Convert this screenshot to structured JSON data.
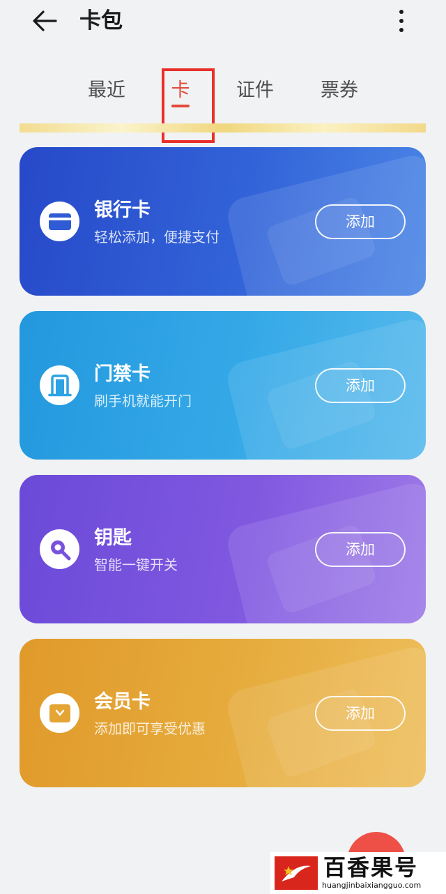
{
  "header": {
    "title": "卡包"
  },
  "tabs": [
    {
      "label": "最近",
      "active": false
    },
    {
      "label": "卡",
      "active": true
    },
    {
      "label": "证件",
      "active": false
    },
    {
      "label": "票券",
      "active": false
    }
  ],
  "cards": [
    {
      "title": "银行卡",
      "subtitle": "轻松添加，便捷支付",
      "button": "添加",
      "icon": "credit-card-icon",
      "color": "#2f5bd4"
    },
    {
      "title": "门禁卡",
      "subtitle": "刷手机就能开门",
      "button": "添加",
      "icon": "door-icon",
      "color": "#2da3e3"
    },
    {
      "title": "钥匙",
      "subtitle": "智能一键开关",
      "button": "添加",
      "icon": "key-search-icon",
      "color": "#7752dd"
    },
    {
      "title": "会员卡",
      "subtitle": "添加即可享受优惠",
      "button": "添加",
      "icon": "member-card-icon",
      "color": "#e4a535"
    }
  ],
  "colors": {
    "active_tab": "#e24a3b",
    "background": "#f1f2f4",
    "fab": "#ee5048"
  },
  "watermark": {
    "title": "百香果号",
    "url": "huangjinbaixiangguo.com"
  }
}
